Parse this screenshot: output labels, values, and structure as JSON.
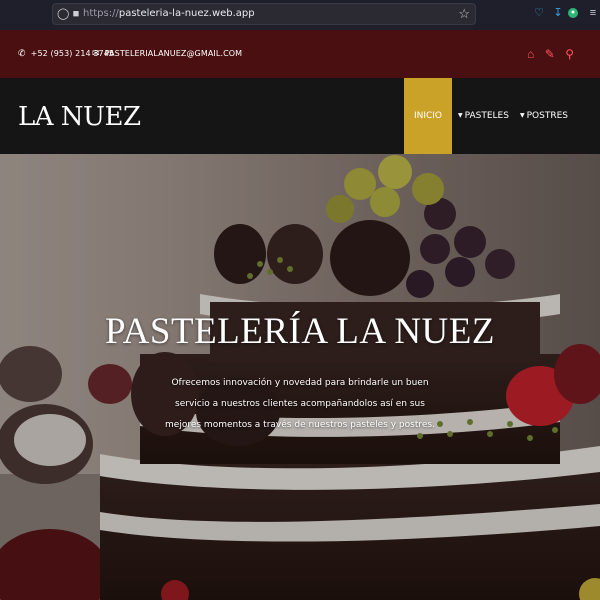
{
  "browser": {
    "url_protocol": "https://",
    "url_host": "pasteleria-la-nuez.web.app"
  },
  "topbar": {
    "phone": "+52 (953) 214 3745",
    "email": "PASTELERIALANUEZ@GMAIL.COM",
    "icons": [
      "home-icon",
      "edit-icon",
      "search-icon"
    ],
    "background": "#4a0f10",
    "icon_color": "#ff5560"
  },
  "navbar": {
    "logo": "LA NUEZ",
    "items": [
      {
        "label": "INICIO",
        "active": true
      },
      {
        "label": "PASTELES",
        "dropdown": true
      },
      {
        "label": "POSTRES",
        "dropdown": true
      }
    ],
    "active_color": "#c9a227"
  },
  "hero": {
    "title": "PASTELERÍA LA NUEZ",
    "text": "Ofrecemos innovación y novedad para brindarle un buen servicio a nuestros clientes acompañandolos así en sus mejores momentos a través de nuestros pasteles y postres."
  }
}
